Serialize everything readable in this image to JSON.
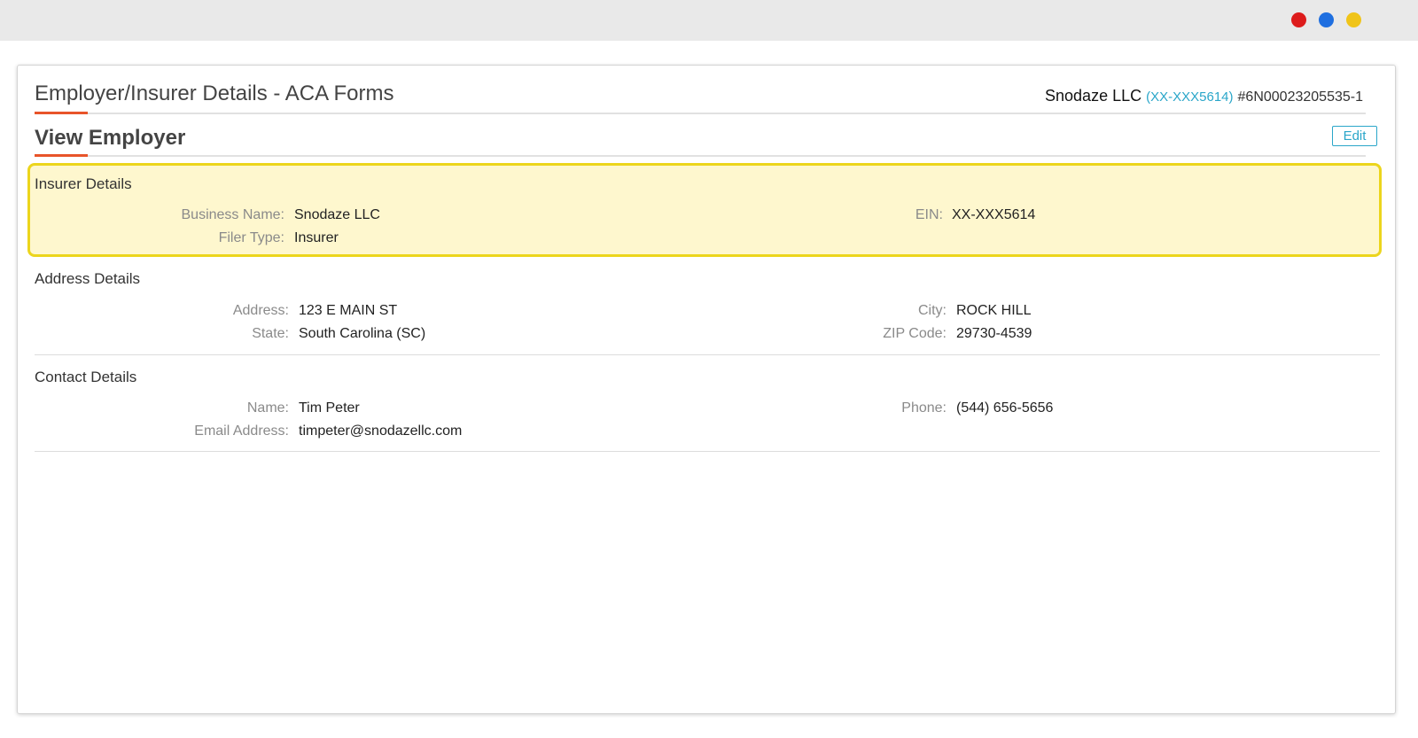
{
  "window": {
    "dots": [
      "#dd1c1c",
      "#1f6fe0",
      "#f0c419"
    ]
  },
  "header": {
    "title": "Employer/Insurer Details - ACA Forms",
    "company_name": "Snodaze LLC",
    "company_ein": "(XX-XXX5614)",
    "company_account": "#6N00023205535-1"
  },
  "view": {
    "title": "View Employer",
    "edit_label": "Edit"
  },
  "insurer": {
    "title": "Insurer Details",
    "business_name_label": "Business Name:",
    "business_name": "Snodaze LLC",
    "ein_label": "EIN:",
    "ein": "XX-XXX5614",
    "filer_type_label": "Filer Type:",
    "filer_type": "Insurer"
  },
  "address": {
    "title": "Address Details",
    "address_label": "Address:",
    "address": "123 E MAIN ST",
    "city_label": "City:",
    "city": "ROCK HILL",
    "state_label": "State:",
    "state": "South Carolina (SC)",
    "zip_label": "ZIP Code:",
    "zip": "29730-4539"
  },
  "contact": {
    "title": "Contact Details",
    "name_label": "Name:",
    "name": "Tim Peter",
    "phone_label": "Phone:",
    "phone": "(544) 656-5656",
    "email_label": "Email Address:",
    "email": "timpeter@snodazellc.com"
  }
}
